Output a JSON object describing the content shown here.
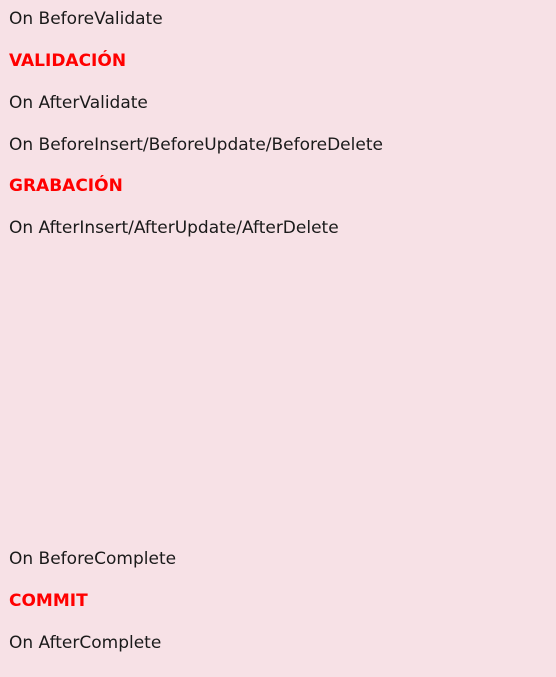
{
  "lines": [
    {
      "text": "On BeforeValidate",
      "kind": "event"
    },
    {
      "text": "VALIDACIÓN",
      "kind": "stage"
    },
    {
      "text": "On AfterValidate",
      "kind": "event"
    },
    {
      "text": "On BeforeInsert/BeforeUpdate/BeforeDelete",
      "kind": "event"
    },
    {
      "text": "GRABACIÓN",
      "kind": "stage"
    },
    {
      "text": "On AfterInsert/AfterUpdate/AfterDelete",
      "kind": "event"
    },
    {
      "text": "On BeforeComplete",
      "kind": "event"
    },
    {
      "text": "COMMIT",
      "kind": "stage"
    },
    {
      "text": "On AfterComplete",
      "kind": "event"
    }
  ],
  "colors": {
    "background": "#f7e1e6",
    "event_text": "#1a1a1a",
    "stage_text": "#ff0000"
  }
}
